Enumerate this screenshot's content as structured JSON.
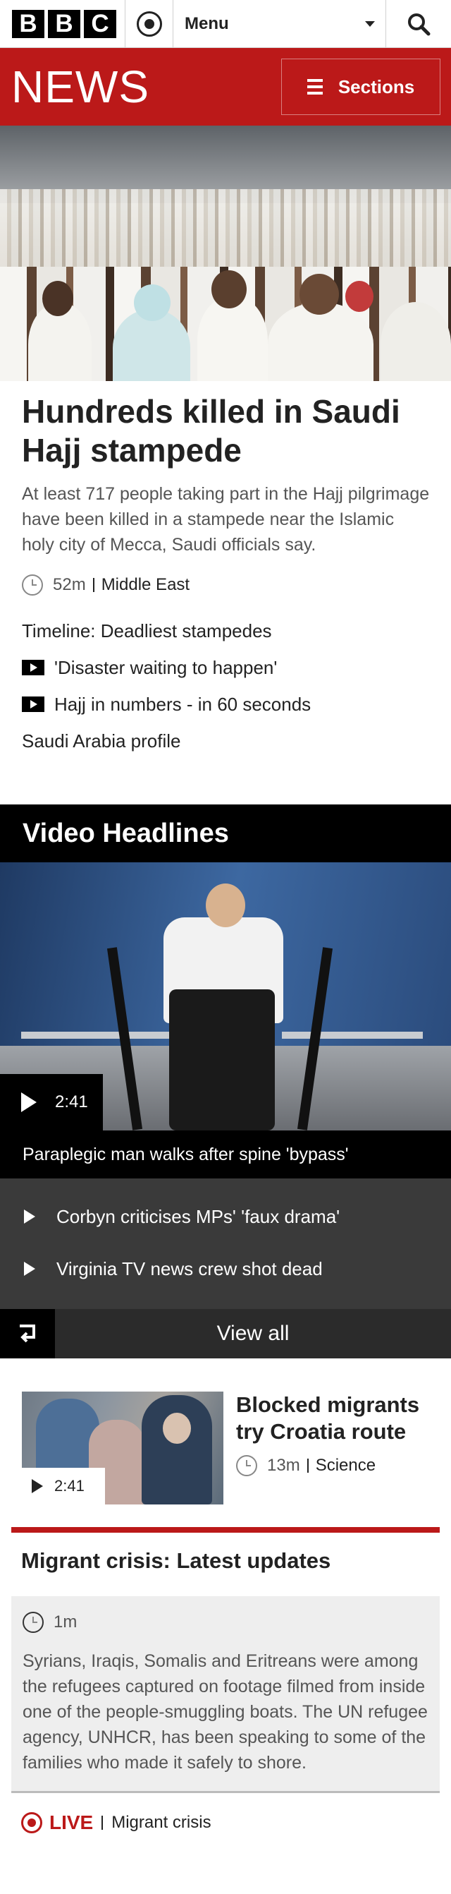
{
  "header": {
    "logo_letters": [
      "B",
      "B",
      "C"
    ],
    "menu_label": "Menu",
    "icons": {
      "account": "account-icon",
      "caret": "chevron-down-icon",
      "search": "search-icon"
    }
  },
  "news_banner": {
    "brand": "NEWS",
    "sections_label": "Sections",
    "color": "#bb1919"
  },
  "lead_story": {
    "headline": "Hundreds killed in Saudi Hajj stampede",
    "summary": "At least 717 people taking part in the Hajj pilgrimage have been killed in a stampede near the Islamic holy city of Mecca, Saudi officials say.",
    "time": "52m",
    "section": "Middle East",
    "related": [
      {
        "label": "Timeline: Deadliest stampedes",
        "video": false
      },
      {
        "label": "'Disaster waiting to happen'",
        "video": true
      },
      {
        "label": "Hajj in numbers - in 60 seconds",
        "video": true
      },
      {
        "label": "Saudi Arabia profile",
        "video": false
      }
    ]
  },
  "video_headlines": {
    "title": "Video Headlines",
    "main": {
      "duration": "2:41",
      "caption": "Paraplegic man walks after spine 'bypass'"
    },
    "items": [
      {
        "label": "Corbyn criticises MPs' 'faux drama'"
      },
      {
        "label": "Virginia TV news crew shot dead"
      }
    ],
    "view_all": "View all"
  },
  "thumb_story": {
    "headline": "Blocked migrants try Croatia route",
    "duration": "2:41",
    "time": "13m",
    "section": "Science"
  },
  "live_module": {
    "heading": "Migrant crisis: Latest updates",
    "time": "1m",
    "body": "Syrians, Iraqis, Somalis and Eritreans were among the refugees captured on footage filmed from inside one of the people-smuggling boats. The UN refugee agency, UNHCR, has been speaking to some of the families who made it safely to shore.",
    "live_label": "LIVE",
    "section": "Migrant crisis"
  }
}
